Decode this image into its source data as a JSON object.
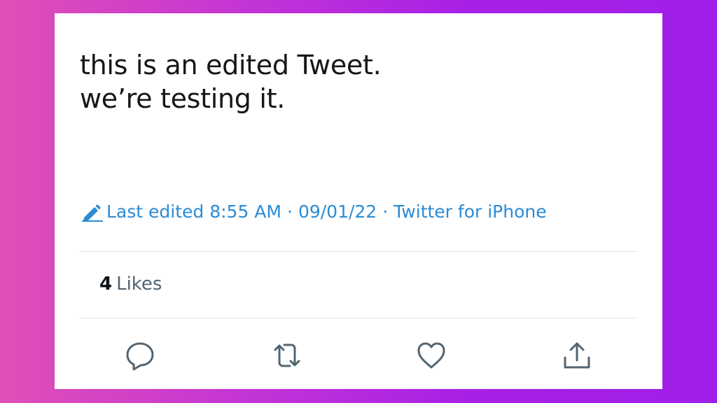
{
  "tweet": {
    "lines": [
      "this is an edited Tweet.",
      "we’re testing it."
    ]
  },
  "meta": {
    "edited_label": "Last edited 8:55 AM",
    "date": "09/01/22",
    "source": "Twitter for iPhone",
    "separator": "·",
    "icon": "pencil-icon",
    "accent_color": "#2c8bd4"
  },
  "likes": {
    "count": "4",
    "label": "Likes"
  },
  "actions": [
    {
      "name": "reply",
      "icon": "reply-icon"
    },
    {
      "name": "retweet",
      "icon": "retweet-icon"
    },
    {
      "name": "like",
      "icon": "heart-icon"
    },
    {
      "name": "share",
      "icon": "share-icon"
    }
  ]
}
